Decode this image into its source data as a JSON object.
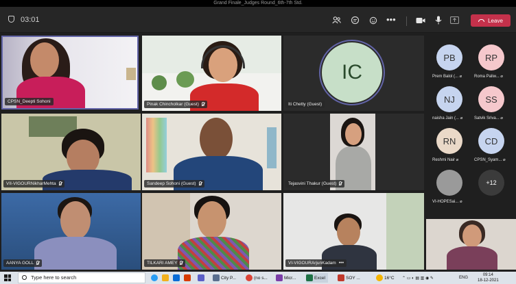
{
  "window": {
    "title": "Grand Finale_Judges Round_6th-7th Std."
  },
  "toolbar": {
    "timer": "03:01",
    "leave_label": "Leave"
  },
  "tiles": [
    {
      "name": "CPSN_Deepti Sohoni"
    },
    {
      "name": "Pinak Chincholkar (Guest)"
    },
    {
      "name": "Iti Chetty (Guest)",
      "initials": "IC"
    },
    {
      "name": "VII-VIGOURNikharMehta"
    },
    {
      "name": "Sandeep Sohoni (Guest)"
    },
    {
      "name": "Tejasvini Thakur (Guest)"
    },
    {
      "name": "AANYA GOLL"
    },
    {
      "name": "TILKARI AMEY"
    },
    {
      "name": "VI-VIGOURArjunKadam"
    }
  ],
  "gallery": [
    {
      "initials": "PB",
      "label": "Prem Balol (...",
      "color": "#c6d4ef"
    },
    {
      "initials": "RP",
      "label": "Roma Paliw...",
      "color": "#f5c8cc"
    },
    {
      "initials": "NJ",
      "label": "naisha Jain (...",
      "color": "#c6d4ef"
    },
    {
      "initials": "SS",
      "label": "Satvik Sriva...",
      "color": "#f5c8cc"
    },
    {
      "initials": "RN",
      "label": "Reshmi Nair",
      "color": "#ead9c8"
    },
    {
      "initials": "CD",
      "label": "CPSN_Syam...",
      "color": "#c6d4ef"
    },
    {
      "initials": "",
      "label": "VI-HOPESai...",
      "color": "#9a9a9a"
    },
    {
      "initials": "+12",
      "label": "",
      "color": "#3b3b3b"
    }
  ],
  "taskbar": {
    "search_placeholder": "Type here to search",
    "items": [
      "City P...",
      "(no s...",
      "Micr...",
      "Excel",
      "SOY ..."
    ],
    "weather": "16°C",
    "language": "ENG",
    "time": "09:14",
    "date": "18-12-2021"
  },
  "colors": {
    "leave": "#c4314b",
    "toolbar": "#262626",
    "taskbar": "#dde3ea"
  }
}
